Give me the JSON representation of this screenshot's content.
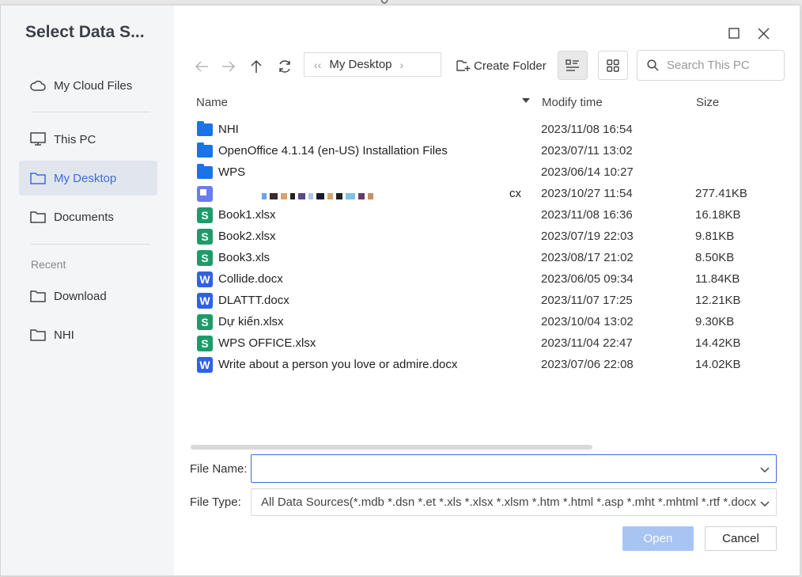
{
  "sidebar": {
    "title": "Select Data S...",
    "items": [
      {
        "label": "My Cloud Files",
        "icon": "cloud-icon"
      },
      {
        "label": "This PC",
        "icon": "monitor-icon"
      },
      {
        "label": "My Desktop",
        "icon": "folder-icon",
        "active": true
      },
      {
        "label": "Documents",
        "icon": "folder-icon"
      }
    ],
    "recent_label": "Recent",
    "recent_items": [
      {
        "label": "Download",
        "icon": "folder-icon"
      },
      {
        "label": "NHI",
        "icon": "folder-icon"
      }
    ]
  },
  "toolbar": {
    "breadcrumb": "My Desktop",
    "create_folder_label": "Create Folder",
    "search_placeholder": "Search This PC"
  },
  "columns": {
    "name": "Name",
    "modify_time": "Modify time",
    "size": "Size"
  },
  "files": [
    {
      "name": "NHI",
      "type": "folder",
      "time": "2023/11/08 16:54",
      "size": ""
    },
    {
      "name": "OpenOffice 4.1.14 (en-US) Installation Files",
      "type": "folder",
      "time": "2023/07/11 13:02",
      "size": ""
    },
    {
      "name": "WPS",
      "type": "folder",
      "time": "2023/06/14 10:27",
      "size": ""
    },
    {
      "name": "cx",
      "type": "image",
      "time": "2023/10/27 11:54",
      "size": "277.41KB"
    },
    {
      "name": "Book1.xlsx",
      "type": "sheet",
      "time": "2023/11/08 16:36",
      "size": "16.18KB"
    },
    {
      "name": "Book2.xlsx",
      "type": "sheet",
      "time": "2023/07/19 22:03",
      "size": "9.81KB"
    },
    {
      "name": "Book3.xls",
      "type": "sheet",
      "time": "2023/08/17 21:02",
      "size": "8.50KB"
    },
    {
      "name": "Collide.docx",
      "type": "doc",
      "time": "2023/06/05 09:34",
      "size": "11.84KB"
    },
    {
      "name": "DLATTT.docx",
      "type": "doc",
      "time": "2023/11/07 17:25",
      "size": "12.21KB"
    },
    {
      "name": "Dự kiến.xlsx",
      "type": "sheet",
      "time": "2023/10/04 13:02",
      "size": "9.30KB"
    },
    {
      "name": "WPS OFFICE.xlsx",
      "type": "sheet",
      "time": "2023/11/04 22:47",
      "size": "14.42KB"
    },
    {
      "name": "Write about a person you love or admire.docx",
      "type": "doc",
      "time": "2023/07/06 22:08",
      "size": "14.02KB"
    }
  ],
  "form": {
    "file_name_label": "File Name:",
    "file_name_value": "",
    "file_type_label": "File Type:",
    "file_type_value": "All Data Sources(*.mdb *.dsn *.et *.xls *.xlsx *.xlsm *.htm *.html *.asp *.mht *.mhtml *.rtf *.docx"
  },
  "buttons": {
    "open": "Open",
    "cancel": "Cancel"
  },
  "colors": {
    "accent": "#3f6bd9",
    "folder": "#1a73e8",
    "sheet": "#1e9b6b",
    "doc": "#2f61e6",
    "open_disabled": "#a8c4f3"
  }
}
